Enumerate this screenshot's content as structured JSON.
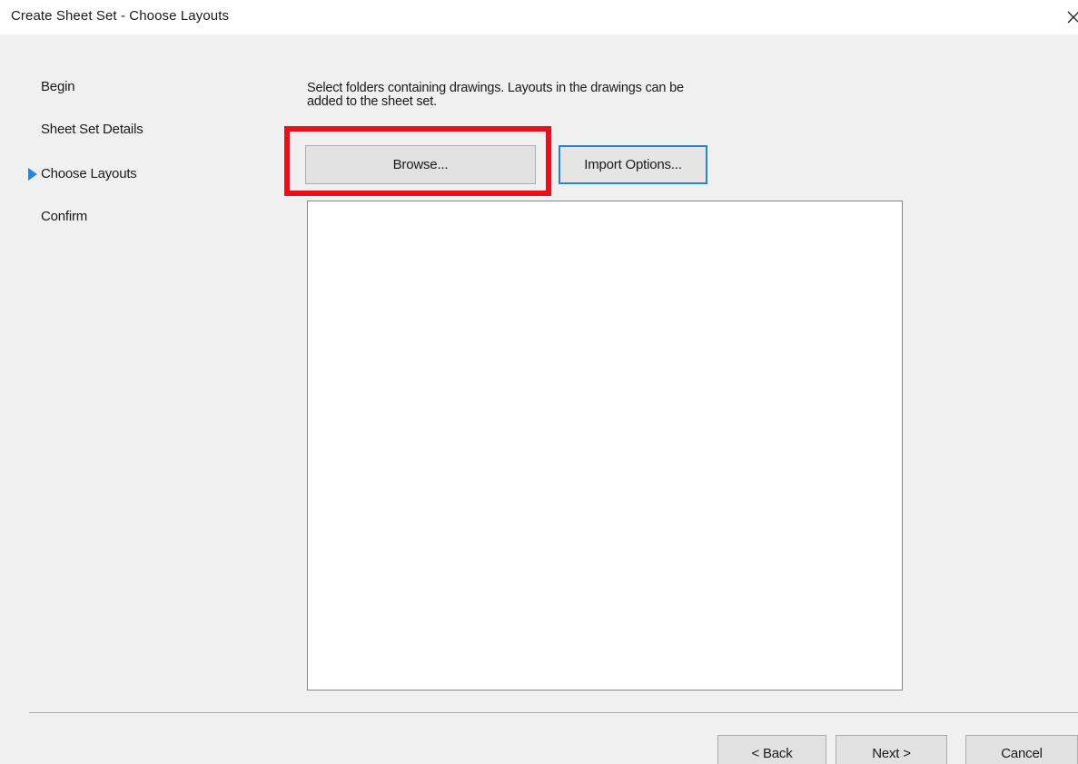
{
  "window": {
    "title": "Create Sheet Set - Choose Layouts",
    "close_glyph": "×"
  },
  "steps": {
    "items": [
      {
        "label": "Begin"
      },
      {
        "label": "Sheet Set Details"
      },
      {
        "label": "Choose Layouts",
        "current": true
      },
      {
        "label": "Confirm"
      }
    ],
    "current_indicator": "play-arrow-icon"
  },
  "main": {
    "instruction": "Select folders containing drawings.  Layouts in the drawings can be added to the sheet set.",
    "browse_label": "Browse...",
    "import_options_label": "Import Options...",
    "folders_list": []
  },
  "footer": {
    "back_label": "< Back",
    "next_label": "Next >",
    "cancel_label": "Cancel"
  },
  "colors": {
    "highlight": "#e8101a",
    "accent": "#1e88e5",
    "focus_border": "#2a82d7"
  }
}
